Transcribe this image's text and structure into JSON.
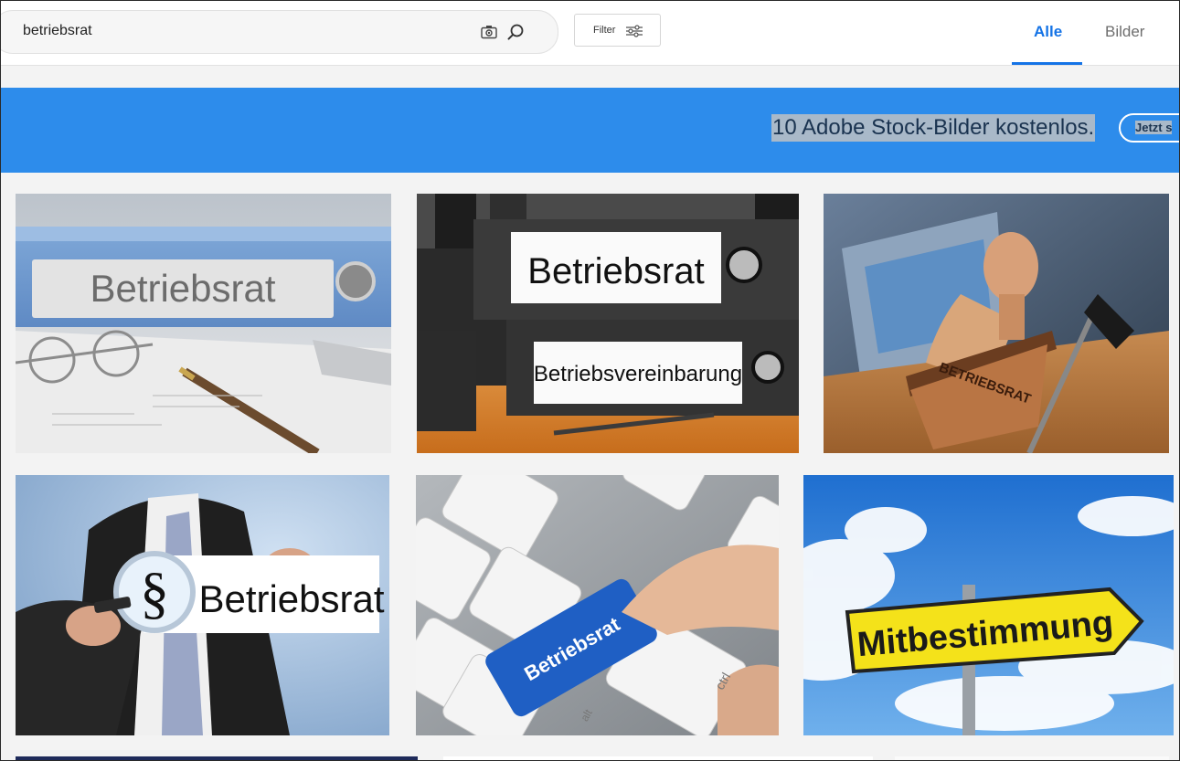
{
  "search": {
    "query": "betriebsrat"
  },
  "filter": {
    "label": "Filter"
  },
  "tabs": [
    {
      "label": "Alle"
    },
    {
      "label": "Bilder"
    }
  ],
  "banner": {
    "text": "10 Adobe Stock-Bilder kostenlos.",
    "button": "Jetzt s"
  },
  "tiles": [
    {
      "label": "Betriebsrat"
    },
    {
      "label1": "Betriebsrat",
      "label2": "Betriebsvereinbarung"
    },
    {
      "label": "BETRIEBSRAT"
    },
    {
      "symbol": "§",
      "label": "Betriebsrat"
    },
    {
      "label": "Betriebsrat",
      "keys": [
        "ctrl",
        "alt"
      ]
    },
    {
      "label": "Mitbestimmung"
    }
  ],
  "colors": {
    "accent": "#1473e6",
    "banner": "#2d8ceb"
  }
}
